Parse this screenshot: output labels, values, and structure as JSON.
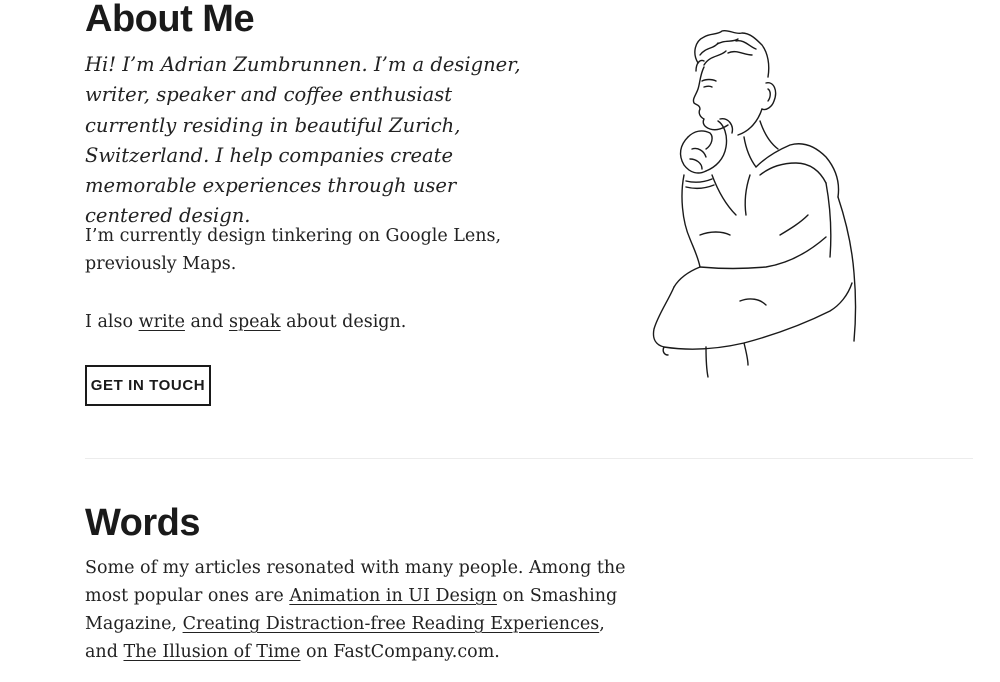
{
  "about": {
    "heading": "About Me",
    "intro": "Hi! I’m Adrian Zumbrunnen. I’m a designer, writer, speaker and coffee enthusiast currently residing in beautiful Zurich, Switzerland. I help companies create memorable experiences through user centered design.",
    "current": "I’m currently design tinkering on Google Lens, previously Maps.",
    "also_prefix": "I also ",
    "write_link": "write",
    "also_mid": " and ",
    "speak_link": "speak",
    "also_suffix": " about design.",
    "cta_label": "GET IN TOUCH",
    "illustration_icon": "thinking-man-sketch"
  },
  "words": {
    "heading": "Words",
    "text_1": "Some of my articles resonated with many people. Among the most popular ones are ",
    "link_1": "Animation in UI Design",
    "text_2": " on Smashing Magazine, ",
    "link_2": "Creating Distraction-free Reading Experiences",
    "text_3": ", and ",
    "link_3": "The Illusion of Time",
    "text_4": " on FastCompany.com."
  },
  "colors": {
    "text": "#1a1a1a",
    "background": "#ffffff",
    "divider": "#ececec"
  }
}
